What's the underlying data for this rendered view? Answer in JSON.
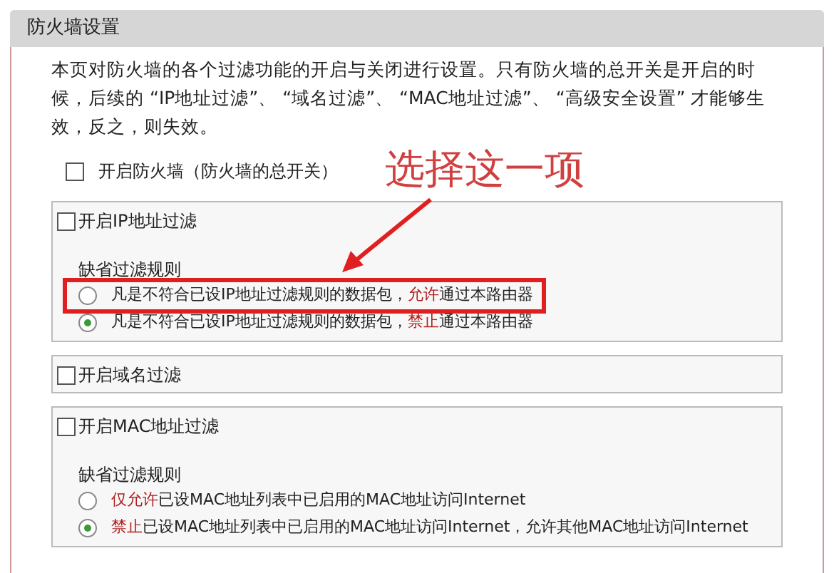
{
  "panel": {
    "title": "防火墙设置"
  },
  "intro": "本页对防火墙的各个过滤功能的开启与关闭进行设置。只有防火墙的总开关是开启的时候，后续的 “IP地址过滤”、 “域名过滤”、 “MAC地址过滤”、 “高级安全设置” 才能够生效，反之，则失效。",
  "master_switch": {
    "label": "开启防火墙（防火墙的总开关）",
    "checked": false
  },
  "annotation": {
    "text": "选择这一项"
  },
  "sections": [
    {
      "label": "开启IP地址过滤",
      "checked": false,
      "rules_label": "缺省过滤规则",
      "options": [
        {
          "selected": false,
          "highlighted": true,
          "parts": [
            {
              "text": "凡是不符合已设IP地址过滤规则的数据包，",
              "emphasis": false
            },
            {
              "text": "允许",
              "emphasis": true
            },
            {
              "text": "通过本路由器",
              "emphasis": false
            }
          ]
        },
        {
          "selected": true,
          "highlighted": false,
          "parts": [
            {
              "text": "凡是不符合已设IP地址过滤规则的数据包，",
              "emphasis": false
            },
            {
              "text": "禁止",
              "emphasis": true
            },
            {
              "text": "通过本路由器",
              "emphasis": false
            }
          ]
        }
      ]
    },
    {
      "label": "开启域名过滤",
      "checked": false
    },
    {
      "label": "开启MAC地址过滤",
      "checked": false,
      "rules_label": "缺省过滤规则",
      "options": [
        {
          "selected": false,
          "highlighted": false,
          "parts": [
            {
              "text": "仅允许",
              "emphasis": true
            },
            {
              "text": "已设MAC地址列表中已启用的MAC地址访问Internet",
              "emphasis": false
            }
          ]
        },
        {
          "selected": true,
          "highlighted": false,
          "parts": [
            {
              "text": "禁止",
              "emphasis": true
            },
            {
              "text": "已设MAC地址列表中已启用的MAC地址访问Internet，允许其他MAC地址访问Internet",
              "emphasis": false
            }
          ]
        }
      ]
    }
  ]
}
